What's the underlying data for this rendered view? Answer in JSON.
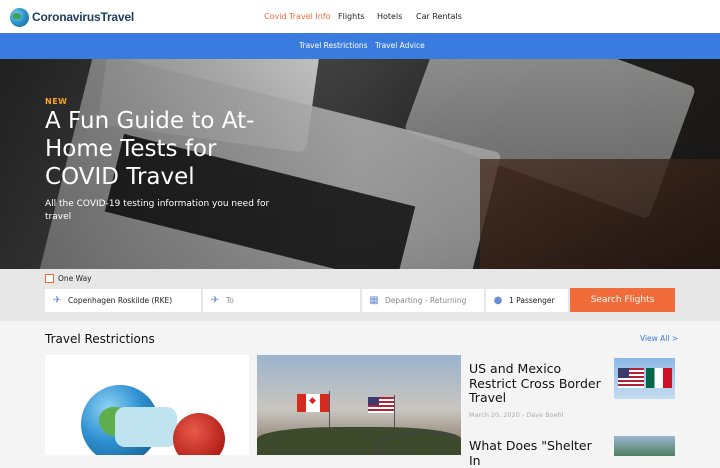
{
  "brand": {
    "name": "CoronavirusTravel"
  },
  "nav": {
    "items": [
      "Covid Travel Info",
      "Flights",
      "Hotels",
      "Car Rentals"
    ],
    "active_index": 0
  },
  "subnav": {
    "items": [
      "Travel Restrictions",
      "Travel Advice"
    ]
  },
  "hero": {
    "tag": "NEW",
    "title": "A Fun Guide to At-Home Tests for COVID Travel",
    "subtitle": "All the COVID-19 testing information you need for travel"
  },
  "search": {
    "one_way_label": "One Way",
    "one_way_checked": false,
    "from_value": "Copenhagen Roskilde (RKE)",
    "to_placeholder": "To",
    "dates_placeholder": "Departing - Returning",
    "passengers_value": "1 Passenger",
    "button_label": "Search Flights"
  },
  "section": {
    "title": "Travel Restrictions",
    "view_all": "View All >"
  },
  "articles": [
    {
      "title": "US and Mexico Restrict Cross Border Travel",
      "meta": "March 20, 2020 - Dave Boehl"
    },
    {
      "title": "What Does \"Shelter In",
      "meta": ""
    }
  ],
  "colors": {
    "accent": "#f26b3a",
    "brand_blue": "#3a7be0",
    "new_tag": "#f5a623"
  },
  "icons": {
    "logo": "globe-icon",
    "from": "plane-takeoff-icon",
    "to": "plane-landing-icon",
    "dates": "calendar-icon",
    "passengers": "person-icon"
  }
}
